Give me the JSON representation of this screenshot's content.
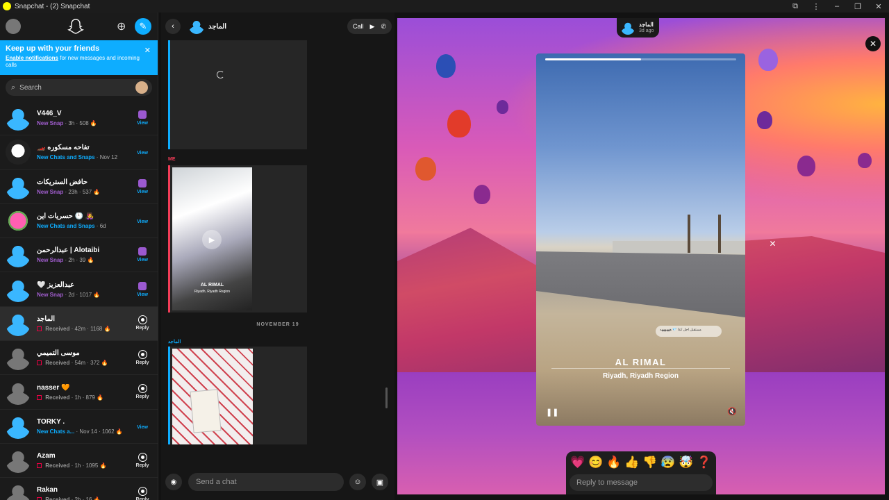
{
  "window": {
    "title": "Snapchat - (2) Snapchat",
    "controls": [
      "extensions",
      "more",
      "minimize",
      "maximize",
      "close"
    ]
  },
  "sidebar": {
    "banner": {
      "title": "Keep up with your friends",
      "link": "Enable notifications",
      "text": " for new messages and incoming calls"
    },
    "search_placeholder": "Search",
    "rows": [
      {
        "name": "V446_V",
        "status": "New Snap",
        "status_color": "purple",
        "time": "3h",
        "streak": "508 🔥",
        "action": "View",
        "avatar": "blue"
      },
      {
        "name": "🏎️ تفاحه مسكوره",
        "status": "New Chats and Snaps",
        "status_color": "blue",
        "time": "Nov 12",
        "streak": "",
        "action": "View",
        "avatar": "face"
      },
      {
        "name": "حافض الستريكات",
        "status": "New Snap",
        "status_color": "purple",
        "time": "23h",
        "streak": "537 🔥",
        "action": "View",
        "avatar": "blue"
      },
      {
        "name": "حسريات اين 🕛 👩‍🎤",
        "status": "New Chats and Snaps",
        "status_color": "blue",
        "time": "6d",
        "streak": "",
        "action": "View",
        "avatar": "pink"
      },
      {
        "name": "عبدالرحمن | Alotaibi",
        "status": "New Snap",
        "status_color": "purple",
        "time": "2h",
        "streak": "39 🔥",
        "action": "View",
        "avatar": "blue"
      },
      {
        "name": "🤍 عبدالعزيز",
        "status": "New Snap",
        "status_color": "purple",
        "time": "2d",
        "streak": "1017 🔥",
        "action": "View",
        "avatar": "blue"
      },
      {
        "name": "الماجد",
        "status": "Received",
        "status_color": "gray",
        "time": "42m",
        "streak": "1168 🔥",
        "action": "Reply",
        "avatar": "blue",
        "selected": true
      },
      {
        "name": "موسى التميمي",
        "status": "Received",
        "status_color": "gray",
        "time": "54m",
        "streak": "372 🔥",
        "action": "Reply",
        "avatar": "gray"
      },
      {
        "name": "nasser 🧡",
        "status": "Received",
        "status_color": "gray",
        "time": "1h",
        "streak": "879 🔥",
        "action": "Reply",
        "avatar": "gray"
      },
      {
        "name": "TORKY .",
        "status": "New Chats a...",
        "status_color": "blue",
        "time": "Nov 14",
        "streak": "1062 🔥",
        "action": "View",
        "avatar": "blue"
      },
      {
        "name": "Azam",
        "status": "Received",
        "status_color": "gray",
        "time": "1h",
        "streak": "1095 🔥",
        "action": "Reply",
        "avatar": "gray"
      },
      {
        "name": "Rakan",
        "status": "Received",
        "status_color": "gray",
        "time": "2h",
        "streak": "16 🔥",
        "action": "Reply",
        "avatar": "gray"
      }
    ]
  },
  "chat": {
    "name": "الماجد",
    "call_label": "Call",
    "me_label": "ME",
    "date_separator": "NOVEMBER 19",
    "sender_label": "الماجد",
    "media1": {
      "caption": "AL RIMAL",
      "subcaption": "Riyadh, Riyadh Region"
    },
    "input_placeholder": "Send a chat"
  },
  "story": {
    "user": "الماجد",
    "ago": "3d ago",
    "location": "AL RIMAL",
    "region": "Riyadh, Riyadh Region",
    "progress": 0.5,
    "sticker_text": "مستقبل اجل كذا 💎 ههههههه",
    "reactions": [
      "💗",
      "😊",
      "🔥",
      "👍",
      "👎",
      "😰",
      "🤯",
      "❓"
    ],
    "reply_placeholder": "Reply to message"
  }
}
